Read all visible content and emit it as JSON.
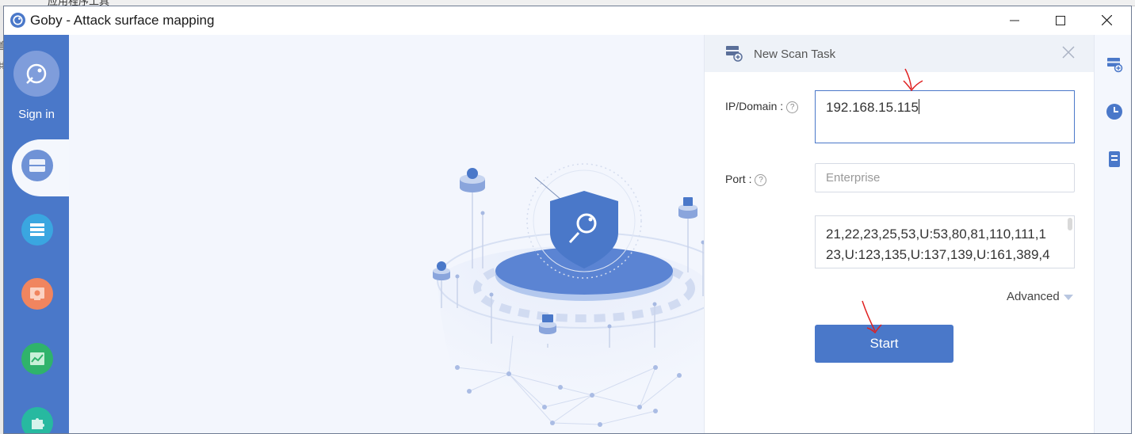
{
  "desktop": {
    "fragments": [
      "应用程序工具",
      "管",
      "共"
    ]
  },
  "window": {
    "title": "Goby - Attack surface mapping"
  },
  "sidebar": {
    "signin_label": "Sign in",
    "items": [
      {
        "name": "scan",
        "color": "#6f92d6"
      },
      {
        "name": "assets",
        "color": "#3aa6e0"
      },
      {
        "name": "vulnerabilities",
        "color": "#f0855f"
      },
      {
        "name": "reports",
        "color": "#2fb36b"
      },
      {
        "name": "extensions",
        "color": "#27b9a0"
      }
    ]
  },
  "panel": {
    "title": "New Scan Task",
    "ip_label": "IP/Domain :",
    "ip_value": "192.168.15.115",
    "port_label": "Port :",
    "port_select": "Enterprise",
    "port_list": "21,22,23,25,53,U:53,80,81,110,111,123,U:123,135,U:137,139,U:161,389,4",
    "advanced_label": "Advanced",
    "start_label": "Start"
  },
  "colors": {
    "accent": "#4a78c9",
    "annotation": "#e02020"
  }
}
